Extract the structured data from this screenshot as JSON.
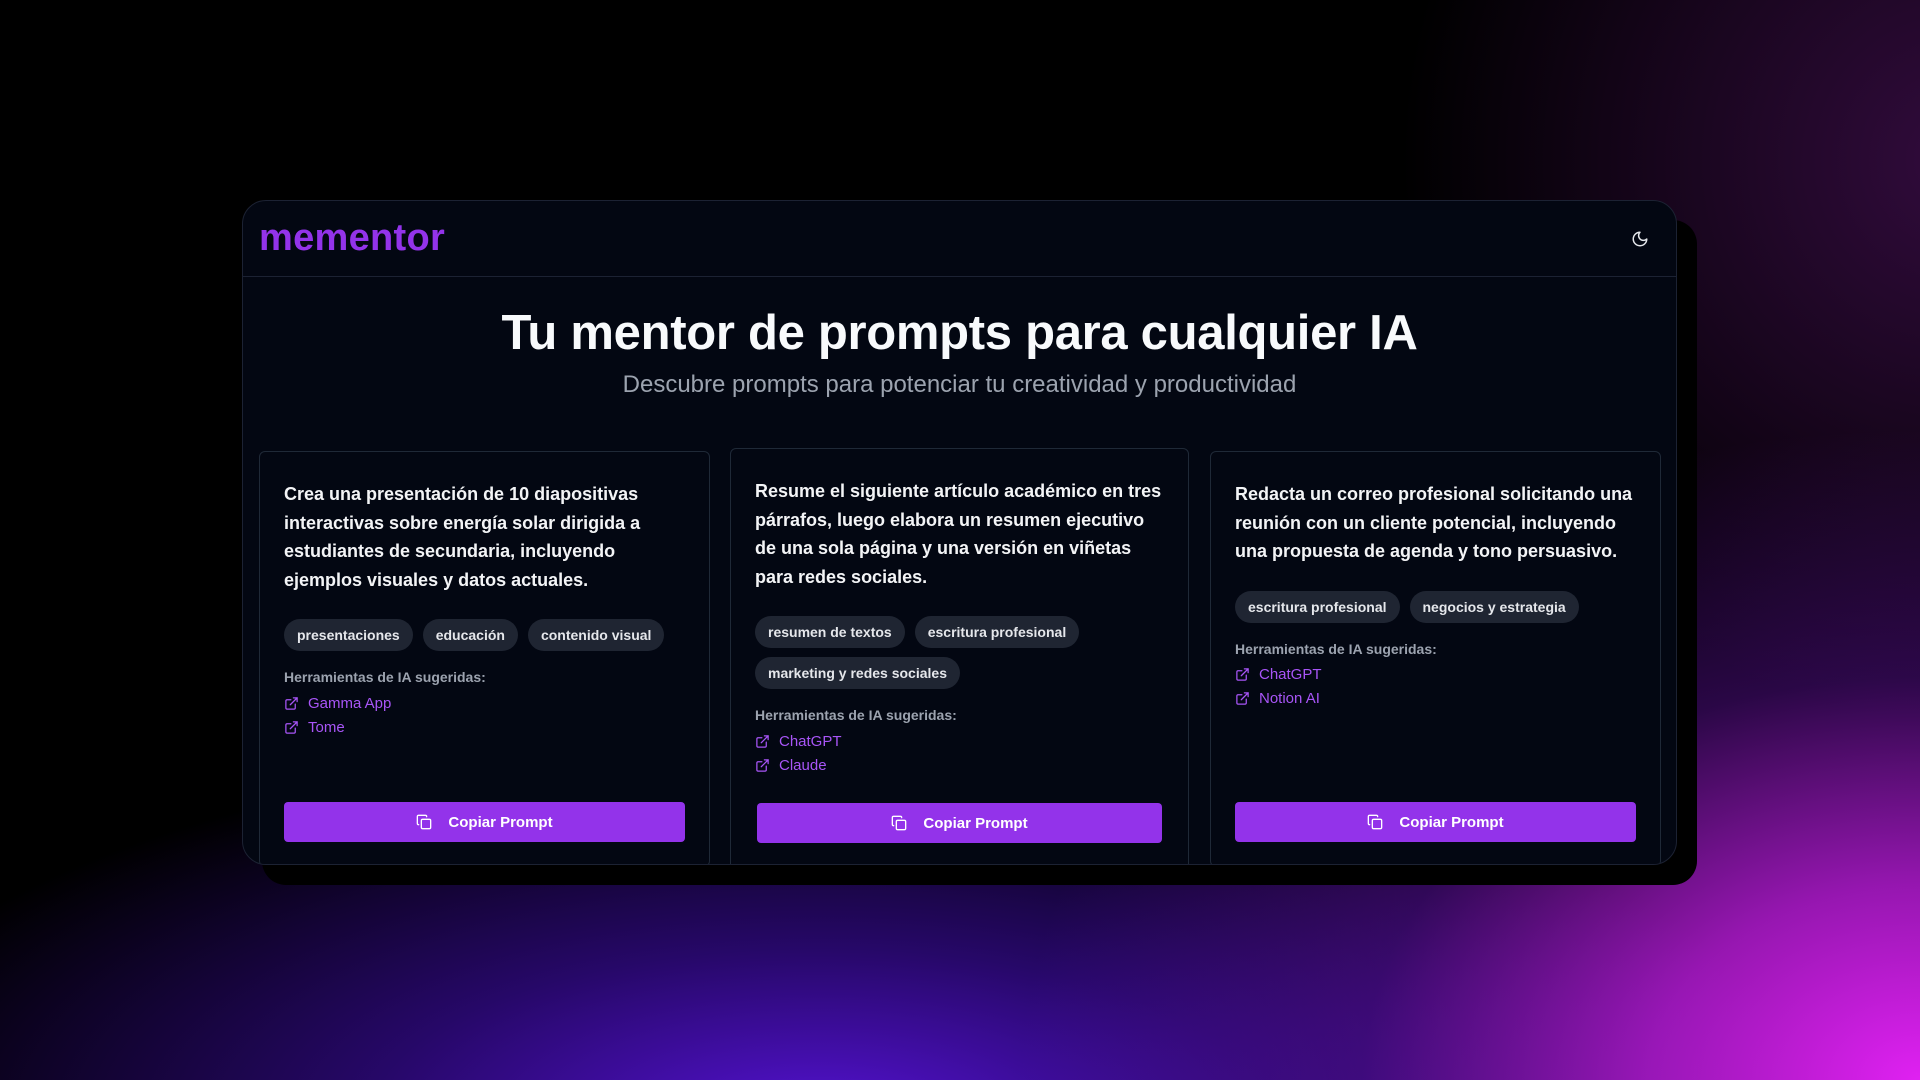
{
  "header": {
    "logo": "mementor",
    "theme_icon": "moon-icon"
  },
  "hero": {
    "title": "Tu mentor de prompts para cualquier IA",
    "subtitle": "Descubre prompts para potenciar tu creatividad y productividad"
  },
  "cards": [
    {
      "prompt": "Crea una presentación de 10 diapositivas interactivas sobre energía solar dirigida a estudiantes de secundaria, incluyendo ejemplos visuales y datos actuales.",
      "tags": [
        "presentaciones",
        "educación",
        "contenido visual"
      ],
      "tools_label": "Herramientas de IA sugeridas:",
      "tools": [
        "Gamma App",
        "Tome"
      ],
      "copy_label": "Copiar Prompt"
    },
    {
      "prompt": "Resume el siguiente artículo académico en tres párrafos, luego elabora un resumen ejecutivo de una sola página y una versión en viñetas para redes sociales.",
      "tags": [
        "resumen de textos",
        "escritura profesional",
        "marketing y redes sociales"
      ],
      "tools_label": "Herramientas de IA sugeridas:",
      "tools": [
        "ChatGPT",
        "Claude"
      ],
      "copy_label": "Copiar Prompt"
    },
    {
      "prompt": "Redacta un correo profesional solicitando una reunión con un cliente potencial, incluyendo una propuesta de agenda y tono persuasivo.",
      "tags": [
        "escritura profesional",
        "negocios y estrategia"
      ],
      "tools_label": "Herramientas de IA sugeridas:",
      "tools": [
        "ChatGPT",
        "Notion AI"
      ],
      "copy_label": "Copiar Prompt"
    }
  ],
  "colors": {
    "accent": "#9333ea",
    "link": "#a855f7",
    "background": "#030712",
    "tag_bg": "#1f2532"
  },
  "icons": {
    "tool_link": "external-link-icon",
    "copy": "copy-icon"
  }
}
